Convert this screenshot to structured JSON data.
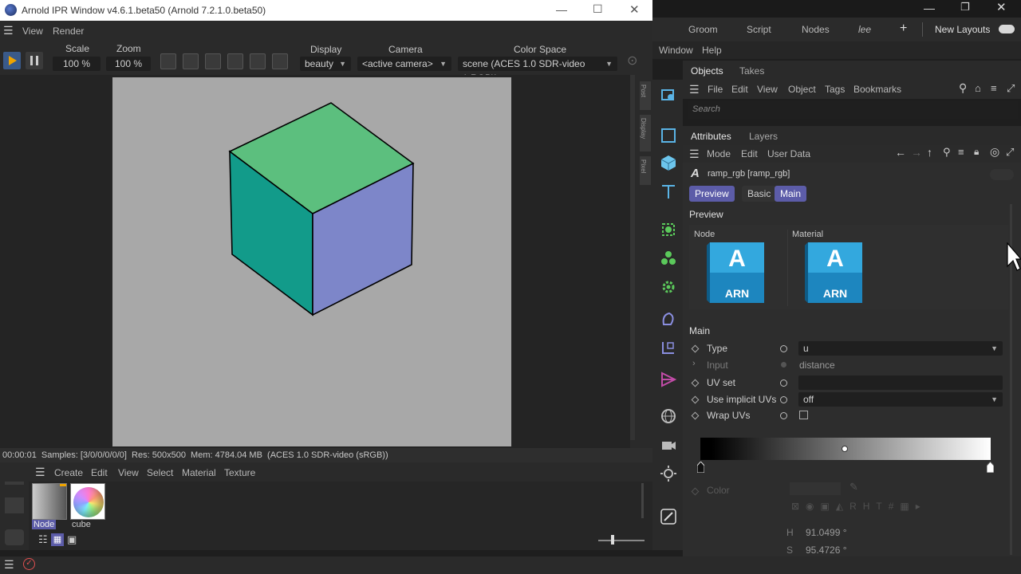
{
  "ipr": {
    "title": "Arnold IPR Window v4.6.1.beta50 (Arnold 7.2.1.0.beta50)",
    "menu": [
      "View",
      "Render"
    ],
    "scale_label": "Scale",
    "scale_value": "100 %",
    "zoom_label": "Zoom",
    "zoom_value": "100 %",
    "display_label": "Display",
    "display_value": "beauty",
    "camera_label": "Camera",
    "camera_value": "<active camera>",
    "colorspace_label": "Color Space",
    "colorspace_value": "scene (ACES 1.0 SDR-video (sRGB))",
    "side_tabs": [
      "Post",
      "Display",
      "Pixel"
    ],
    "status": "00:00:01  Samples: [3/0/0/0/0/0]  Res: 500x500  Mem: 4784.04 MB  (ACES 1.0 SDR-video (sRGB))",
    "cube_colors": {
      "top": "#5cbf7e",
      "left": "#129b8a",
      "right": "#7d86c9"
    }
  },
  "material_manager": {
    "menu": [
      "Create",
      "Edit",
      "View",
      "Select",
      "Material",
      "Texture"
    ],
    "materials": [
      {
        "name": "Node"
      },
      {
        "name": "cube"
      }
    ]
  },
  "c4d": {
    "topbar": [
      "Groom",
      "Script",
      "Nodes",
      "lee"
    ],
    "new_layouts": "New Layouts",
    "menu": [
      "Window",
      "Help"
    ],
    "objects_tabs": [
      "Objects",
      "Takes"
    ],
    "objects_menu": [
      "File",
      "Edit",
      "View",
      "Object",
      "Tags",
      "Bookmarks"
    ],
    "search_placeholder": "Search",
    "attr_tabs": [
      "Attributes",
      "Layers"
    ],
    "attr_menu": [
      "Mode",
      "Edit",
      "User Data"
    ],
    "node_name": "ramp_rgb [ramp_rgb]",
    "node_letter": "A",
    "pills": [
      "Preview",
      "Basic",
      "Main"
    ],
    "preview_heading": "Preview",
    "node_label": "Node",
    "material_label": "Material",
    "arn_letter": "A",
    "arn_text": "ARN",
    "main_heading": "Main",
    "rows": {
      "type_label": "Type",
      "type_value": "u",
      "input_label": "Input",
      "input_value": "distance",
      "uvset_label": "UV set",
      "implicit_label": "Use implicit UVs",
      "implicit_value": "off",
      "wrap_label": "Wrap UVs",
      "color_label": "Color"
    },
    "hsv": {
      "h_label": "H",
      "h_value": "91.0499 °",
      "s_label": "S",
      "s_value": "95.4726 °"
    },
    "accent": "#5c5ca8"
  }
}
